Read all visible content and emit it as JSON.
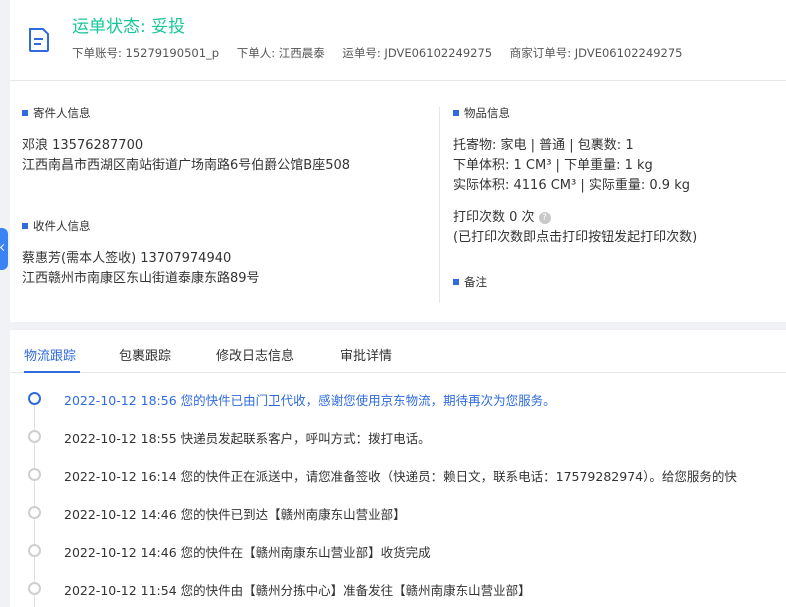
{
  "header": {
    "status_title": "运单状态: 妥投",
    "order_account": "下单账号: 15279190501_p",
    "orderer": "下单人: 江西晨泰",
    "waybill_no": "运单号: JDVE06102249275",
    "merchant_order_no": "商家订单号: JDVE06102249275"
  },
  "sender": {
    "heading": "寄件人信息",
    "name_phone": "邓浪   13576287700",
    "address": "江西南昌市西湖区南站街道广场南路6号伯爵公馆B座508"
  },
  "receiver": {
    "heading": "收件人信息",
    "name_phone": "蔡惠芳(需本人签收)   13707974940",
    "address": "江西赣州市南康区东山街道泰康东路89号"
  },
  "goods": {
    "heading": "物品信息",
    "line1": "托寄物:  家电 | 普通 | 包裹数:  1",
    "line2": "下单体积:    1 CM³ | 下单重量:  1 kg",
    "line3": "实际体积:    4116 CM³ | 实际重量:  0.9 kg",
    "print_count": "打印次数    0 次",
    "help_glyph": "?",
    "print_hint": "(已打印次数即点击打印按钮发起打印次数)"
  },
  "remarks": {
    "heading": "备注"
  },
  "tabs": [
    {
      "label": "物流跟踪",
      "active": true
    },
    {
      "label": "包裹跟踪",
      "active": false
    },
    {
      "label": "修改日志信息",
      "active": false
    },
    {
      "label": "审批详情",
      "active": false
    }
  ],
  "tracking": [
    {
      "text": "2022-10-12 18:56 您的快件已由门卫代收，感谢您使用京东物流，期待再次为您服务。"
    },
    {
      "text": "2022-10-12 18:55 快递员发起联系客户，呼叫方式：拨打电话。"
    },
    {
      "text": "2022-10-12 16:14 您的快件正在派送中，请您准备签收（快递员：赖日文，联系电话：17579282974）。给您服务的快"
    },
    {
      "text": "2022-10-12 14:46 您的快件已到达【赣州南康东山营业部】"
    },
    {
      "text": "2022-10-12 14:46 您的快件在【赣州南康东山营业部】收货完成"
    },
    {
      "text": "2022-10-12 11:54 您的快件由【赣州分拣中心】准备发往【赣州南康东山营业部】"
    }
  ],
  "colors": {
    "status_green": "#16c79b",
    "accent_blue": "#2f6bdf"
  }
}
